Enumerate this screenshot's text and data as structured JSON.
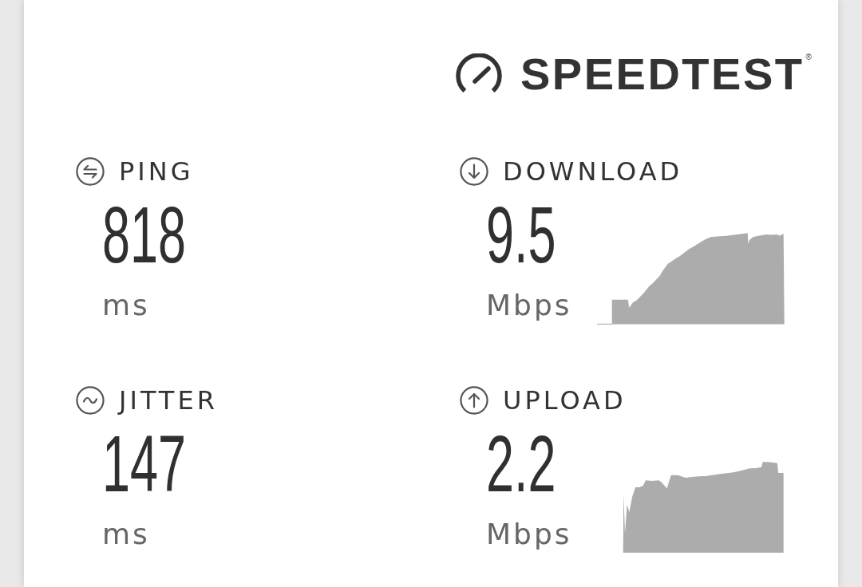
{
  "logo": {
    "text": "SPEEDTEST$^{®}$"
  },
  "metrics": [
    {
      "kind": "ping",
      "label": "PING",
      "value": "818",
      "unit": "ms"
    },
    {
      "kind": "download",
      "label": "DOWNLOAD",
      "value": "9.5",
      "unit": "Mbps"
    },
    {
      "kind": "jitter",
      "label": "JITTER",
      "value": "147",
      "unit": "ms"
    },
    {
      "kind": "upload",
      "label": "UPLOAD",
      "value": "2.2",
      "unit": "Mbps"
    }
  ]
}
